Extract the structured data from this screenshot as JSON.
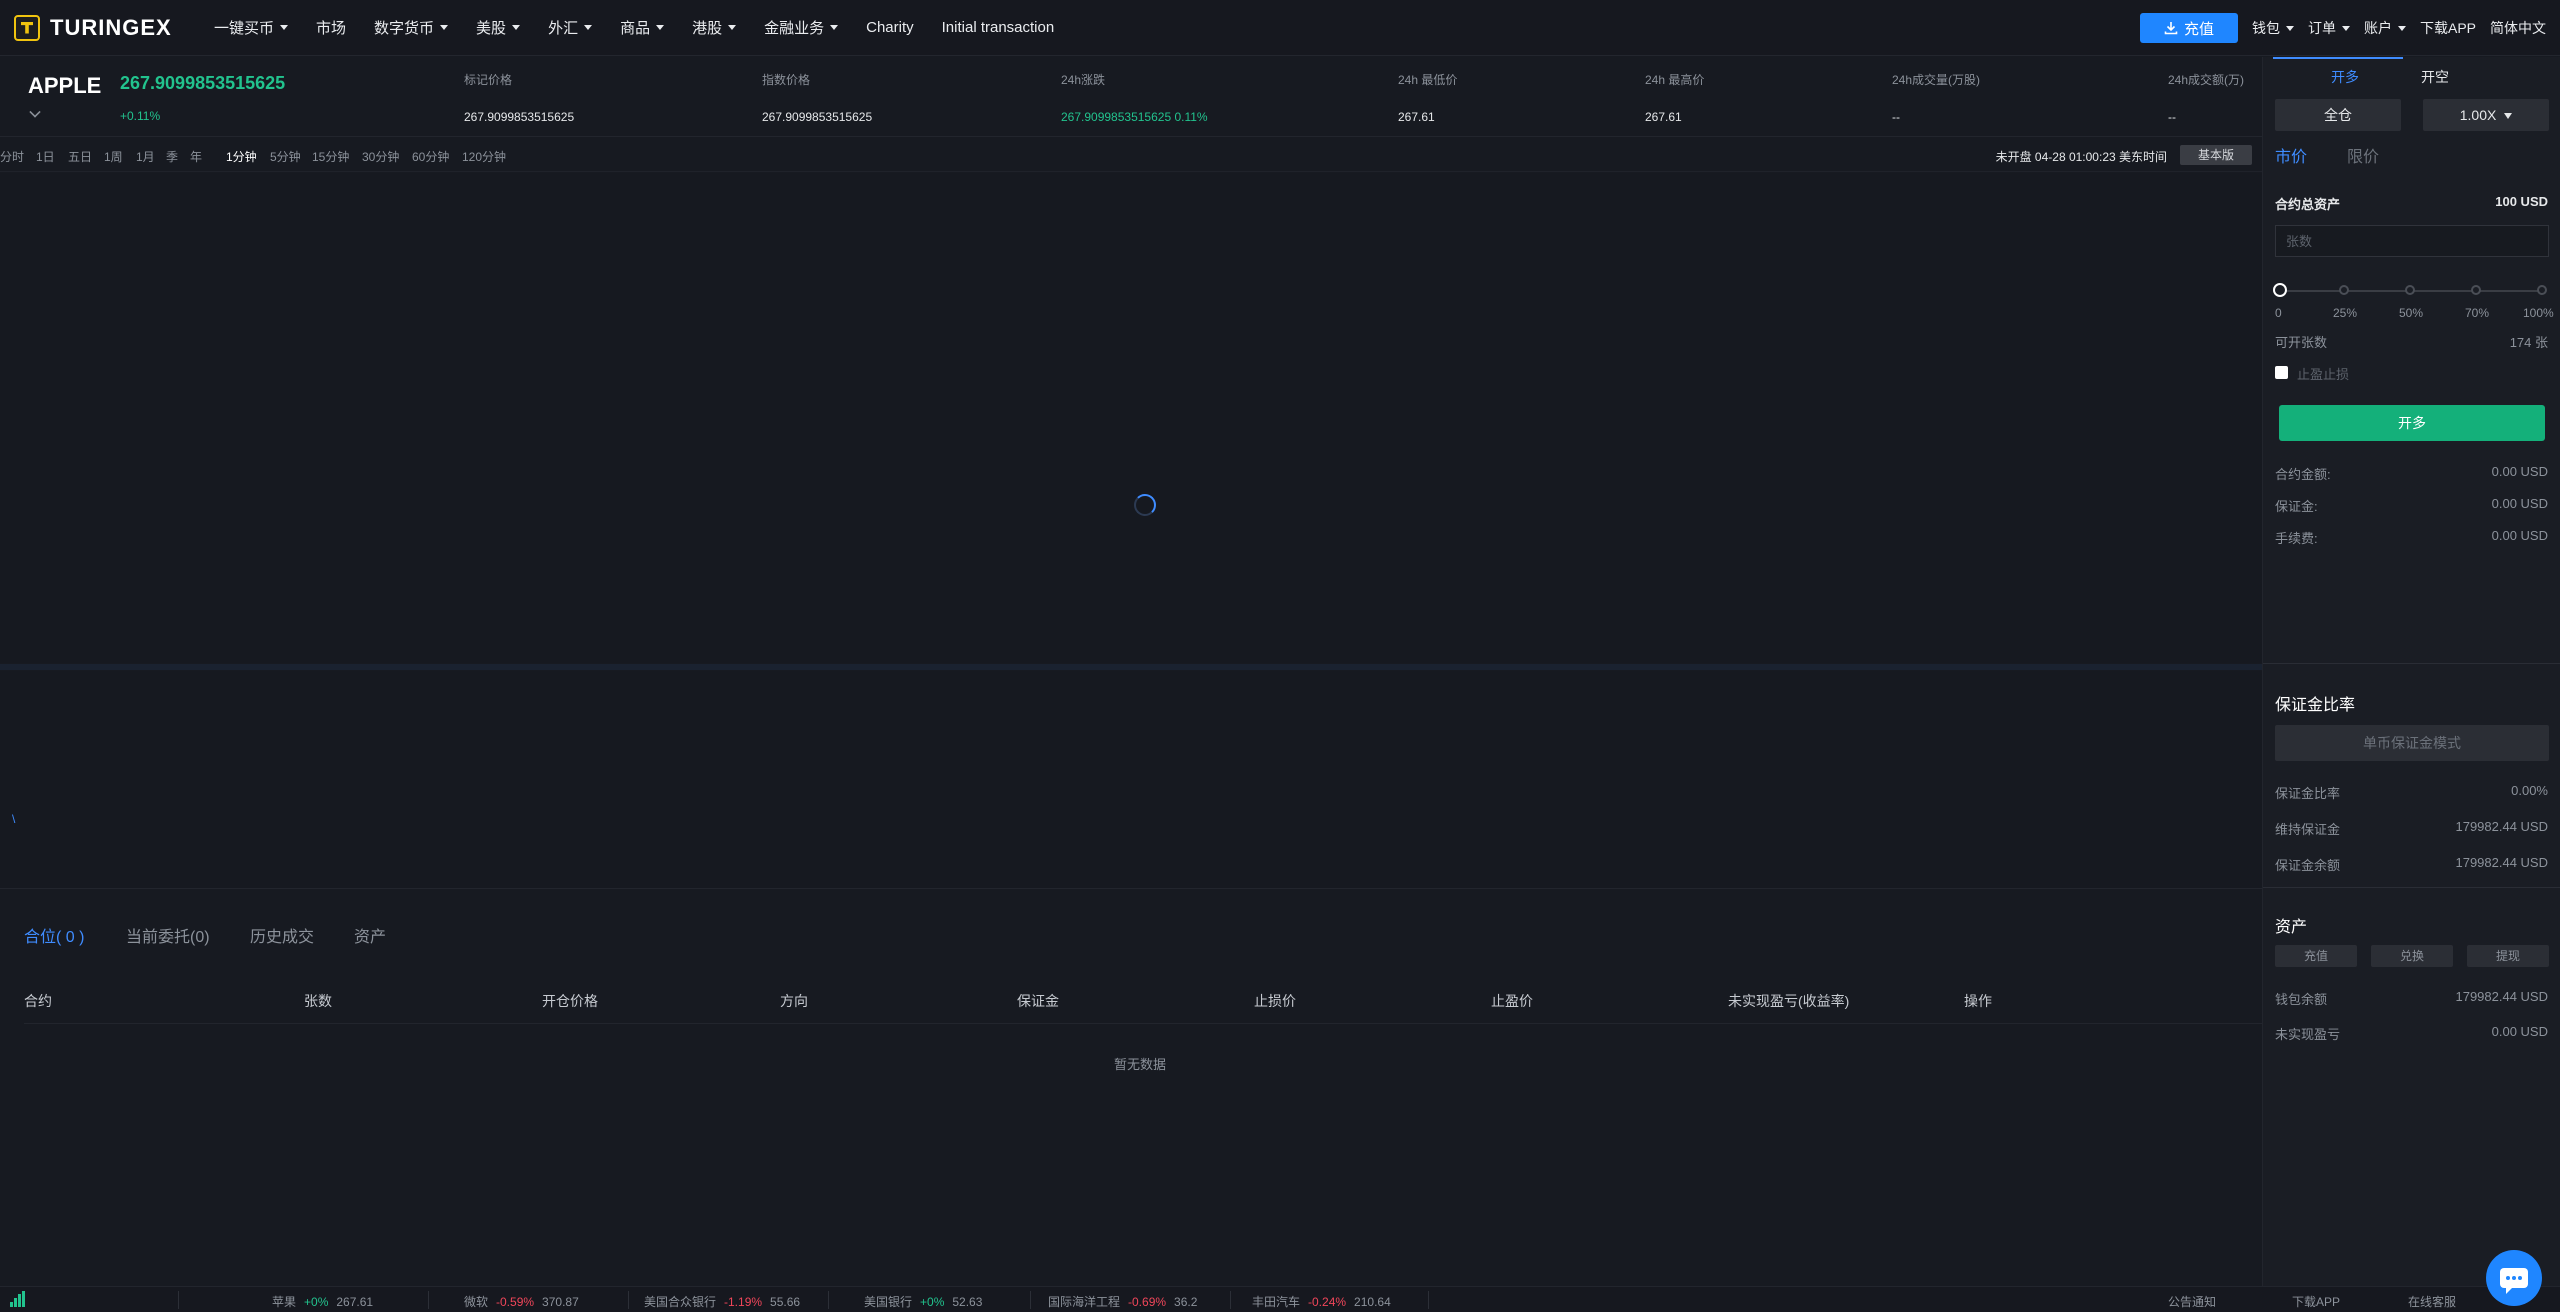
{
  "brand": {
    "name": "TURINGEX"
  },
  "nav": {
    "items": [
      {
        "label": "一键买币",
        "dropdown": true
      },
      {
        "label": "市场",
        "dropdown": false
      },
      {
        "label": "数字货币",
        "dropdown": true
      },
      {
        "label": "美股",
        "dropdown": true
      },
      {
        "label": "外汇",
        "dropdown": true
      },
      {
        "label": "商品",
        "dropdown": true
      },
      {
        "label": "港股",
        "dropdown": true
      },
      {
        "label": "金融业务",
        "dropdown": true
      },
      {
        "label": "Charity",
        "dropdown": false
      },
      {
        "label": "Initial transaction",
        "dropdown": false
      }
    ],
    "deposit_label": "充值",
    "right_items": [
      {
        "label": "钱包",
        "dropdown": true
      },
      {
        "label": "订单",
        "dropdown": true
      },
      {
        "label": "账户",
        "dropdown": true
      },
      {
        "label": "下载APP",
        "dropdown": false
      },
      {
        "label": "简体中文",
        "dropdown": false
      }
    ]
  },
  "ticker": {
    "symbol": "APPLE",
    "last_price": "267.9099853515625",
    "change": "+0.11%",
    "stats": [
      {
        "key": "标记价格",
        "value": "267.9099853515625"
      },
      {
        "key": "指数价格",
        "value": "267.9099853515625"
      },
      {
        "key": "24h涨跌",
        "value": "267.9099853515625  0.11%"
      },
      {
        "key": "24h 最低价",
        "value": "267.61"
      },
      {
        "key": "24h 最高价",
        "value": "267.61"
      },
      {
        "key": "24h成交量(万股)",
        "value": "--"
      },
      {
        "key": "24h成交额(万)",
        "value": "--"
      }
    ]
  },
  "chart_toolbar": {
    "periods": [
      "分时",
      "1日",
      "五日",
      "1周",
      "1月",
      "季",
      "年"
    ],
    "intervals": [
      "1分钟",
      "5分钟",
      "15分钟",
      "30分钟",
      "60分钟",
      "120分钟"
    ],
    "active_interval": "1分钟",
    "market_status": "未开盘 04-28 01:00:23  美东时间",
    "view_label": "基本版"
  },
  "sub_chart_mark": "\\",
  "positions": {
    "tabs": [
      "合位( 0 )",
      "当前委托(0)",
      "历史成交",
      "资产"
    ],
    "columns": [
      "合约",
      "张数",
      "开仓价格",
      "方向",
      "保证金",
      "止损价",
      "止盈价",
      "未实现盈亏(收益率)",
      "操作"
    ],
    "empty_text": "暂无数据"
  },
  "order_panel": {
    "tab_long": "开多",
    "tab_short": "开空",
    "margin_mode": "全仓",
    "leverage": "1.00X",
    "order_types": [
      "市价",
      "限价"
    ],
    "total_assets_label": "合约总资产",
    "total_assets_value": "100 USD",
    "qty_placeholder": "张数",
    "slider_labels": [
      "0",
      "25%",
      "50%",
      "70%",
      "100%"
    ],
    "slider_value": 0,
    "available_label": "可开张数",
    "available_value": "174 张",
    "sltp_label": "止盈止损",
    "open_button": "开多",
    "summary": [
      {
        "key": "合约金额:",
        "value": "0.00 USD"
      },
      {
        "key": "保证金:",
        "value": "0.00 USD"
      },
      {
        "key": "手续费:",
        "value": "0.00 USD"
      }
    ],
    "margin_ratio": {
      "title": "保证金比率",
      "mode_button": "单币保证金模式",
      "rows": [
        {
          "key": "保证金比率",
          "value": "0.00%"
        },
        {
          "key": "维持保证金",
          "value": "179982.44 USD"
        },
        {
          "key": "保证金余额",
          "value": "179982.44 USD"
        }
      ]
    },
    "assets": {
      "title": "资产",
      "buttons": [
        "充值",
        "兑换",
        "提现"
      ],
      "rows": [
        {
          "key": "钱包余额",
          "value": "179982.44 USD"
        },
        {
          "key": "未实现盈亏",
          "value": "0.00 USD"
        }
      ]
    }
  },
  "bottom_ticker": [
    {
      "name": "苹果",
      "change": "+0%",
      "dir": "up",
      "price": "267.61"
    },
    {
      "name": "微软",
      "change": "-0.59%",
      "dir": "dn",
      "price": "370.87"
    },
    {
      "name": "美国合众银行",
      "change": "-1.19%",
      "dir": "dn",
      "price": "55.66"
    },
    {
      "name": "美国银行",
      "change": "+0%",
      "dir": "up",
      "price": "52.63"
    },
    {
      "name": "国际海洋工程",
      "change": "-0.69%",
      "dir": "dn",
      "price": "36.2"
    },
    {
      "name": "丰田汽车",
      "change": "-0.24%",
      "dir": "dn",
      "price": "210.64"
    }
  ],
  "bottom_links": [
    "公告通知",
    "下载APP",
    "在线客服"
  ],
  "colors": {
    "up": "#22c38e",
    "down": "#f0465a",
    "accent": "#1f86ff",
    "open_long": "#14b07a"
  }
}
